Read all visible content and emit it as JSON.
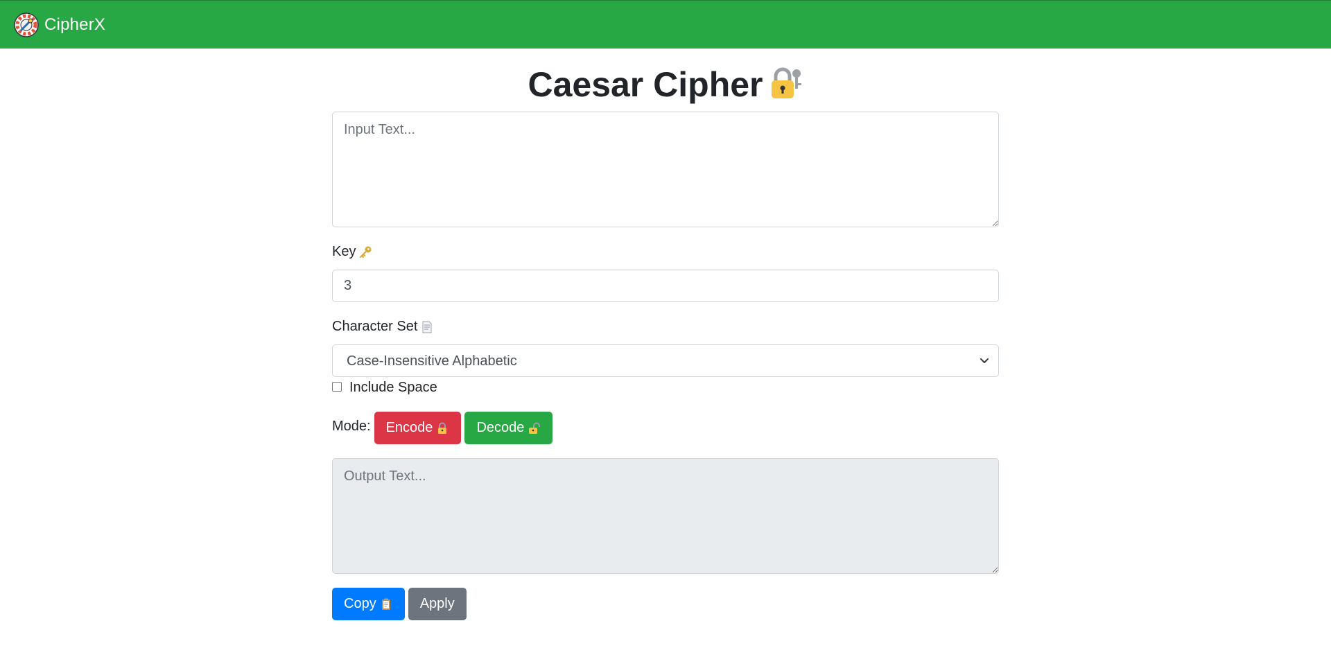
{
  "app": {
    "brand_name": "CipherX",
    "logo_icon": "cipher-wheel-icon"
  },
  "page": {
    "title": "Caesar Cipher",
    "title_icon": "lock-with-key-icon"
  },
  "input": {
    "placeholder": "Input Text...",
    "value": ""
  },
  "key": {
    "label": "Key",
    "icon": "key-icon",
    "value": "3"
  },
  "charset": {
    "label": "Character Set",
    "icon": "page-icon",
    "selected": "Case-Insensitive Alphabetic"
  },
  "include_space": {
    "label": "Include Space",
    "checked": false
  },
  "mode": {
    "label": "Mode:",
    "encode_label": "Encode",
    "encode_icon": "locked-icon",
    "decode_label": "Decode",
    "decode_icon": "unlocked-icon"
  },
  "output": {
    "placeholder": "Output Text...",
    "value": ""
  },
  "actions": {
    "copy_label": "Copy",
    "copy_icon": "clipboard-icon",
    "apply_label": "Apply"
  },
  "colors": {
    "navbar": "#28a745",
    "encode": "#dc3545",
    "decode": "#28a745",
    "copy": "#007bff",
    "apply": "#6c757d",
    "output_bg": "#e9ecef"
  }
}
